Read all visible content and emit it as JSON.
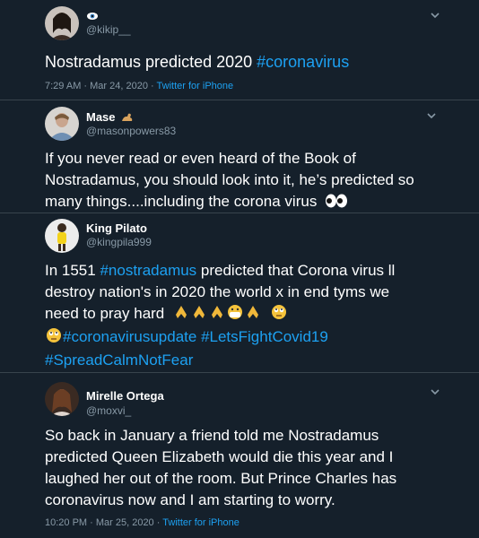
{
  "colors": {
    "background": "#15202b",
    "text": "#ffffff",
    "muted": "#8899a6",
    "link": "#1da1f2",
    "divider": "#38444d"
  },
  "tweets": [
    {
      "name": "",
      "name_emoji": "eye-emoji",
      "handle": "@kikip__",
      "text": "Nostradamus predicted 2020 ",
      "hashtags": [
        "#coronavirus"
      ],
      "time": "7:29 AM · Mar 24, 2020 · ",
      "source": "Twitter for iPhone"
    },
    {
      "name": "Mase",
      "name_emoji": "flexed-arm-emoji",
      "handle": "@masonpowers83",
      "lines": [
        "If you never read or even heard of the Book of",
        "Nostradamus, you should look  into it, he’s predicted so",
        "many things....including the corona virus"
      ],
      "emoji": "eyes-emoji"
    },
    {
      "name": "King Pilato",
      "handle": "@kingpila999",
      "line1_a": "In 1551 ",
      "line1_tag": "#nostradamus",
      "line1_b": " predicted that Corona virus ll",
      "line2": "destroy nation's in 2020 the world x in end tyms we",
      "line3": "need to pray hard",
      "line3_emojis": [
        "folded-hands-emoji",
        "folded-hands-emoji",
        "folded-hands-emoji",
        "face-with-mask-emoji",
        "folded-hands-emoji",
        "rolling-eyes-emoji"
      ],
      "line4_tags": [
        "#coronavirusupdate",
        "#LetsFightCovid19"
      ],
      "line5_tag": "#SpreadCalmNotFear"
    },
    {
      "name": "Mirelle Ortega",
      "handle": "@moxvi_",
      "lines": [
        "So back in January a friend told me Nostradamus",
        "predicted Queen Elizabeth would die this year and I",
        "laughed her out of the room. But Prince Charles has",
        "coronavirus now and I am starting to worry."
      ],
      "time": "10:20 PM · Mar 25, 2020 · ",
      "source": "Twitter for iPhone"
    }
  ]
}
